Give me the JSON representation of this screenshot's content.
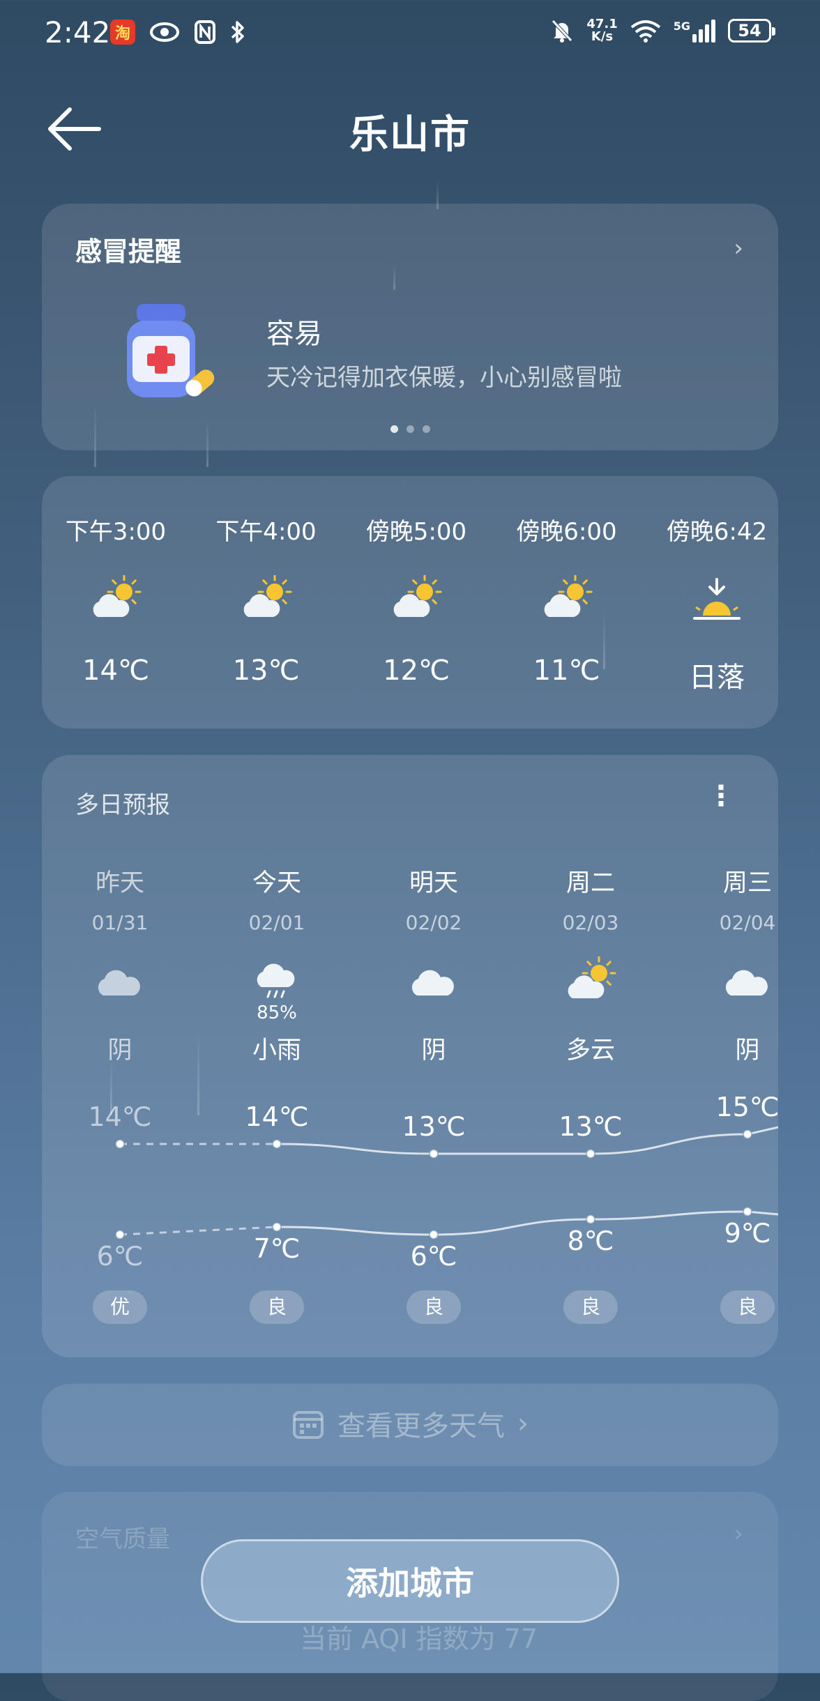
{
  "status_bar": {
    "time": "2:42",
    "app_badge": "淘",
    "net_speed_top": "47.1",
    "net_speed_bottom": "K/s",
    "network": "5G",
    "battery": "54"
  },
  "header": {
    "city": "乐山市"
  },
  "cold_card": {
    "title": "感冒提醒",
    "status": "容易",
    "desc": "天冷记得加衣保暖，小心别感冒啦",
    "pages": 3,
    "active_page": 0
  },
  "hourly": [
    {
      "time": "下午3:00",
      "icon": "partly-sunny-icon",
      "value": "14℃"
    },
    {
      "time": "下午4:00",
      "icon": "partly-sunny-icon",
      "value": "13℃"
    },
    {
      "time": "傍晚5:00",
      "icon": "partly-sunny-icon",
      "value": "12℃"
    },
    {
      "time": "傍晚6:00",
      "icon": "partly-sunny-icon",
      "value": "11℃"
    },
    {
      "time": "傍晚6:42",
      "icon": "sunset-icon",
      "value": "日落"
    }
  ],
  "forecast": {
    "title": "多日预报",
    "days": [
      {
        "name": "昨天",
        "date": "01/31",
        "icon": "cloudy-icon",
        "precip": "",
        "weather": "阴",
        "high": "14℃",
        "low": "6℃",
        "aq": "优"
      },
      {
        "name": "今天",
        "date": "02/01",
        "icon": "light-rain-icon",
        "precip": "85%",
        "weather": "小雨",
        "high": "14℃",
        "low": "7℃",
        "aq": "良"
      },
      {
        "name": "明天",
        "date": "02/02",
        "icon": "cloudy-icon",
        "precip": "",
        "weather": "阴",
        "high": "13℃",
        "low": "6℃",
        "aq": "良"
      },
      {
        "name": "周二",
        "date": "02/03",
        "icon": "partly-sunny-icon",
        "precip": "",
        "weather": "多云",
        "high": "13℃",
        "low": "8℃",
        "aq": "良"
      },
      {
        "name": "周三",
        "date": "02/04",
        "icon": "cloudy-icon",
        "precip": "",
        "weather": "阴",
        "high": "15℃",
        "low": "9℃",
        "aq": "良"
      }
    ]
  },
  "chart_data": {
    "type": "line",
    "categories": [
      "01/31",
      "02/01",
      "02/02",
      "02/03",
      "02/04"
    ],
    "series": [
      {
        "values": [
          14,
          14,
          13,
          13,
          15
        ]
      },
      {
        "values": [
          6,
          7,
          6,
          8,
          9
        ]
      }
    ]
  },
  "more_weather": {
    "label": "查看更多天气"
  },
  "air_quality": {
    "title": "空气质量",
    "aqi_text": "当前 AQI 指数为 77"
  },
  "add_city": {
    "label": "添加城市"
  },
  "colors": {
    "sun": "#f7c531",
    "cloud": "#eef3f8",
    "accent_bg": "#3b5672"
  }
}
